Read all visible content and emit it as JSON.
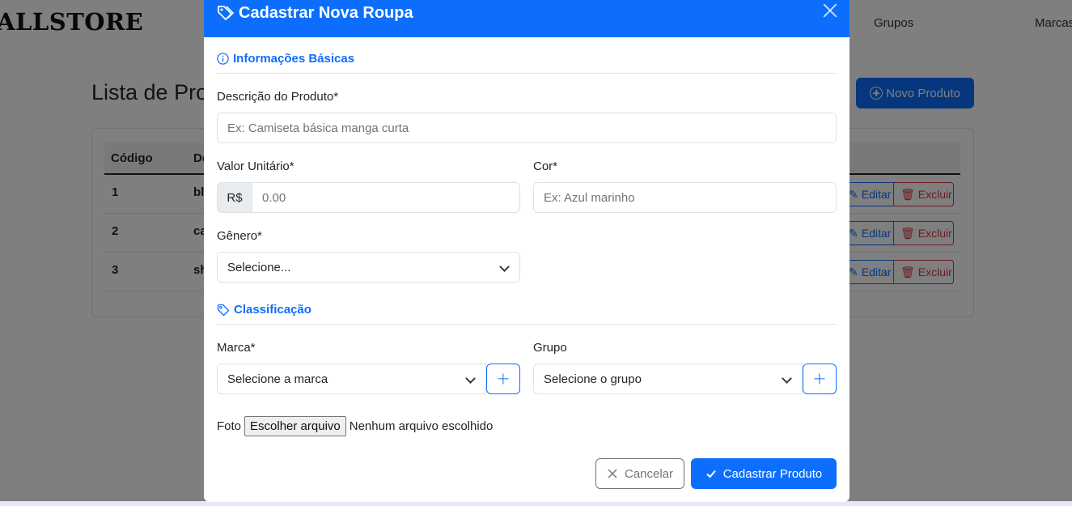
{
  "navbar": {
    "brand": "ALLSTORE",
    "links": [
      "Grupos",
      "Marcas"
    ]
  },
  "page": {
    "title": "Lista de Produtos",
    "new_button": "Novo Produto"
  },
  "table": {
    "headers": [
      "Código",
      "De"
    ],
    "rows": [
      {
        "codigo": "1",
        "descricao": "bl"
      },
      {
        "codigo": "2",
        "descricao": "ca"
      },
      {
        "codigo": "3",
        "descricao": "sh"
      }
    ],
    "edit_label": "Editar",
    "delete_label": "Excluir"
  },
  "modal": {
    "title": "Cadastrar Nova Roupa",
    "section_basic": "Informações Básicas",
    "section_class": "Classificação",
    "descricao_label": "Descrição do Produto*",
    "descricao_placeholder": "Ex: Camiseta básica manga curta",
    "valor_label": "Valor Unitário*",
    "valor_prefix": "R$",
    "valor_placeholder": "0.00",
    "cor_label": "Cor*",
    "cor_placeholder": "Ex: Azul marinho",
    "genero_label": "Gênero*",
    "genero_value": "Selecione...",
    "marca_label": "Marca*",
    "marca_value": "Selecione a marca",
    "grupo_label": "Grupo",
    "grupo_value": "Selecione o grupo",
    "foto_label": "Foto",
    "file_button": "Escolher arquivo",
    "file_status": "Nenhum arquivo escolhido",
    "cancel_label": "Cancelar",
    "submit_label": "Cadastrar Produto"
  },
  "colors": {
    "primary": "#0d6efd",
    "danger": "#dc3545",
    "secondary": "#6c757d"
  }
}
